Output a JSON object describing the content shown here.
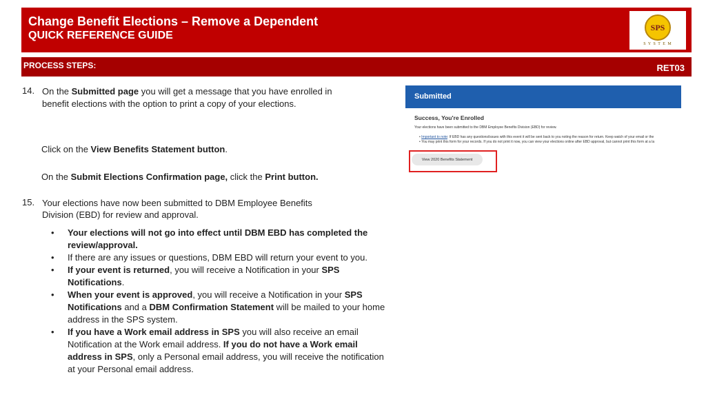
{
  "header": {
    "title": "Change Benefit Elections – Remove a Dependent",
    "subtitle": "QUICK REFERENCE GUIDE",
    "logo_letters": "SPS",
    "logo_text": "S Y S T E M"
  },
  "subbar": {
    "label": "PROCESS STEPS:",
    "code": "RET03"
  },
  "step14": {
    "number": "14.",
    "l1a": "On the ",
    "l1b": "Submitted page",
    "l1c": " you will get a message that you have enrolled in",
    "l2": "benefit elections with the option to print a copy of your elections.",
    "click_a": "Click on the ",
    "click_b": "View Benefits Statement button",
    "click_c": ".",
    "conf_a": "On the ",
    "conf_b": "Submit Elections Confirmation page,",
    "conf_c": " click the ",
    "conf_d": "Print button."
  },
  "step15": {
    "number": "15.",
    "l1": "Your elections have now been submitted to DBM Employee Benefits",
    "l2": "Division (EBD) for review and approval."
  },
  "bullets": {
    "dot": "•",
    "b1": "Your elections will not go into effect until DBM EBD has completed the review/approval.",
    "b2": "If there are any issues or questions, DBM EBD will return your event to you.",
    "b3a": "If your event is returned",
    "b3b": ", you will receive a Notification in your ",
    "b3c": "SPS Notifications",
    "b3d": ".",
    "b4a": "When your event is approved",
    "b4b": ", you will receive a Notification in your ",
    "b4c": "SPS Notifications",
    "b4d": " and a ",
    "b4e": "DBM Confirmation Statement",
    "b4f": " will be mailed to your home address in the SPS system.",
    "b5a": "If you have a Work email address in SPS",
    "b5b": " you will also receive an email Notification at the Work email address.  ",
    "b5c": "If you do not have a Work email address in SPS",
    "b5d": ", only a Personal email address, you will receive the notification at your Personal email address."
  },
  "screenshot": {
    "bar_title": "Submitted",
    "heading": "Success, You're Enrolled",
    "para": "Your elections have been submitted to the DBM Employee Benefits Division (EBD) for review.",
    "bullet1_link": "Important to note",
    "bullet1_rest": ": If EBD has any questions/issues with this event it will be sent back to you noting the reason for return.  Keep watch of your email or the",
    "bullet2": "You may print this form for your records. If you do not print it now, you can view your elections online after EBD approval, but cannot print this form at a la",
    "button": "View 2020 Benefits Statement"
  }
}
